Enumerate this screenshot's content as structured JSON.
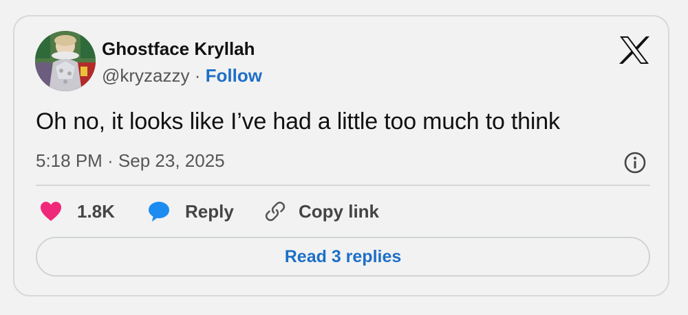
{
  "author": {
    "display_name": "Ghostface Kryllah",
    "handle": "@kryzazzy",
    "separator": "·",
    "follow_label": "Follow"
  },
  "brand_icon": "x-logo-icon",
  "tweet": {
    "text": "Oh no, it looks like I’ve had a little too much to think",
    "timestamp": "5:18 PM · Sep 23, 2025"
  },
  "actions": {
    "like_count": "1.8K",
    "reply_label": "Reply",
    "copy_link_label": "Copy link"
  },
  "read_replies_label": "Read 3 replies",
  "colors": {
    "link_blue": "#1d6fc7",
    "heart_pink": "#f0287a",
    "bubble_blue": "#1d8cf0",
    "background": "#f2f2f2"
  },
  "icons": [
    "avatar",
    "x-logo-icon",
    "info-icon",
    "heart-icon",
    "reply-bubble-icon",
    "link-icon"
  ]
}
